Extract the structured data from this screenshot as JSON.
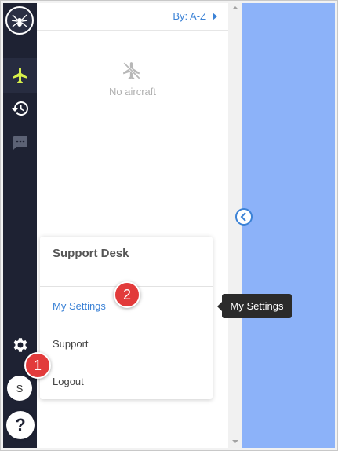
{
  "panel": {
    "sort_label": "By: A-Z",
    "empty_text": "No aircraft"
  },
  "sidebar": {
    "items": [
      {
        "icon": "airplane-icon",
        "active": true
      },
      {
        "icon": "history-icon",
        "active": false
      },
      {
        "icon": "chat-icon",
        "active": false
      },
      {
        "icon": "gear-icon",
        "active": false
      }
    ],
    "avatar_initial": "S",
    "help_label": "?"
  },
  "menu": {
    "title": "Support Desk",
    "items": [
      {
        "label": "My Settings",
        "active": true
      },
      {
        "label": "Support",
        "active": false
      },
      {
        "label": "Logout",
        "active": false
      }
    ]
  },
  "tooltip": {
    "text": "My Settings"
  },
  "badges": {
    "step1": "1",
    "step2": "2"
  },
  "colors": {
    "sidebar": "#1e2233",
    "active_icon": "#d8f04a",
    "accent": "#3b82d6",
    "map": "#8cb2f9",
    "badge": "#e23b3b"
  }
}
